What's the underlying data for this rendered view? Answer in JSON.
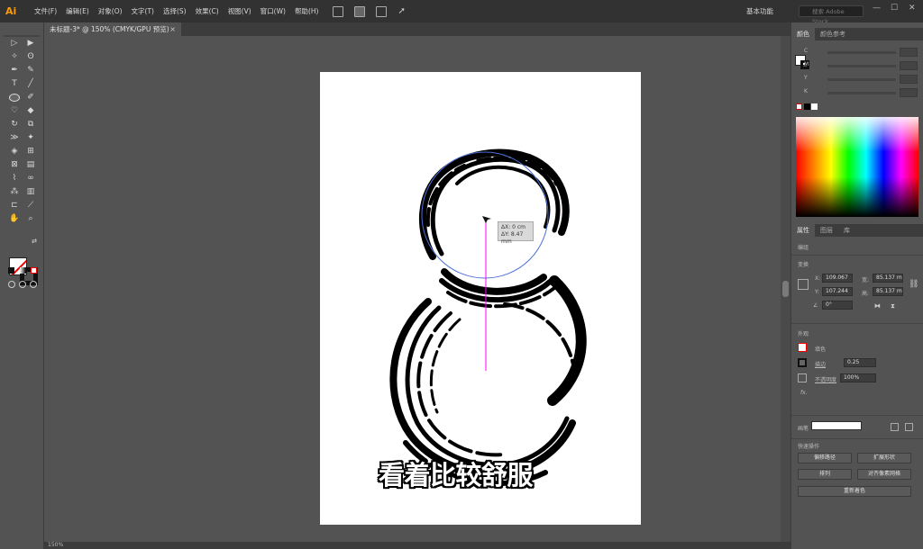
{
  "app": {
    "logo": "Ai"
  },
  "menu": [
    "文件(F)",
    "编辑(E)",
    "对象(O)",
    "文字(T)",
    "选择(S)",
    "效果(C)",
    "视图(V)",
    "窗口(W)",
    "帮助(H)"
  ],
  "workspace": {
    "label": "基本功能",
    "search_placeholder": "搜索 Adobe Stock"
  },
  "window_controls": {
    "minimize": "—",
    "restore": "☐",
    "close": "✕"
  },
  "document_tab": {
    "title": "未标题-3* @ 150% (CMYK/GPU 预览)",
    "close": "×"
  },
  "status": {
    "zoom": "150%"
  },
  "measure": {
    "dx": "ΔX: 0 cm",
    "dy": "ΔY: 8.47 mm"
  },
  "subtitle": "看着比较舒服",
  "color_panel": {
    "tabs": [
      "颜色",
      "颜色参考"
    ],
    "sliders": [
      "C",
      "M",
      "Y",
      "K"
    ]
  },
  "properties_panel": {
    "tabs": [
      "属性",
      "图层",
      "库"
    ],
    "section_graphic": "编组",
    "section_transform": "变换",
    "x_label": "X:",
    "x_value": "109.067",
    "y_label": "Y:",
    "y_value": "107.244",
    "w_label": "宽:",
    "w_value": "85.137 m",
    "h_label": "高:",
    "h_value": "85.137 m",
    "angle_label": "∠",
    "angle_value": "0°",
    "section_appearance": "外观",
    "fill_label": "填色",
    "stroke_label": "描边",
    "stroke_value": "0.25",
    "opacity_label": "不透明度",
    "opacity_value": "100%",
    "fx_label": "fx.",
    "brush_label": "画笔",
    "section_quick": "快速操作",
    "btn_offset_path": "偏移路径",
    "btn_expand": "扩展形状",
    "btn_arrange": "排列",
    "btn_align_pixel": "对齐像素网格",
    "btn_recolor": "重新着色"
  },
  "colors": {
    "accent": "#ff9a00",
    "guide": "#ff00ff",
    "selection": "#4a6fd8"
  }
}
